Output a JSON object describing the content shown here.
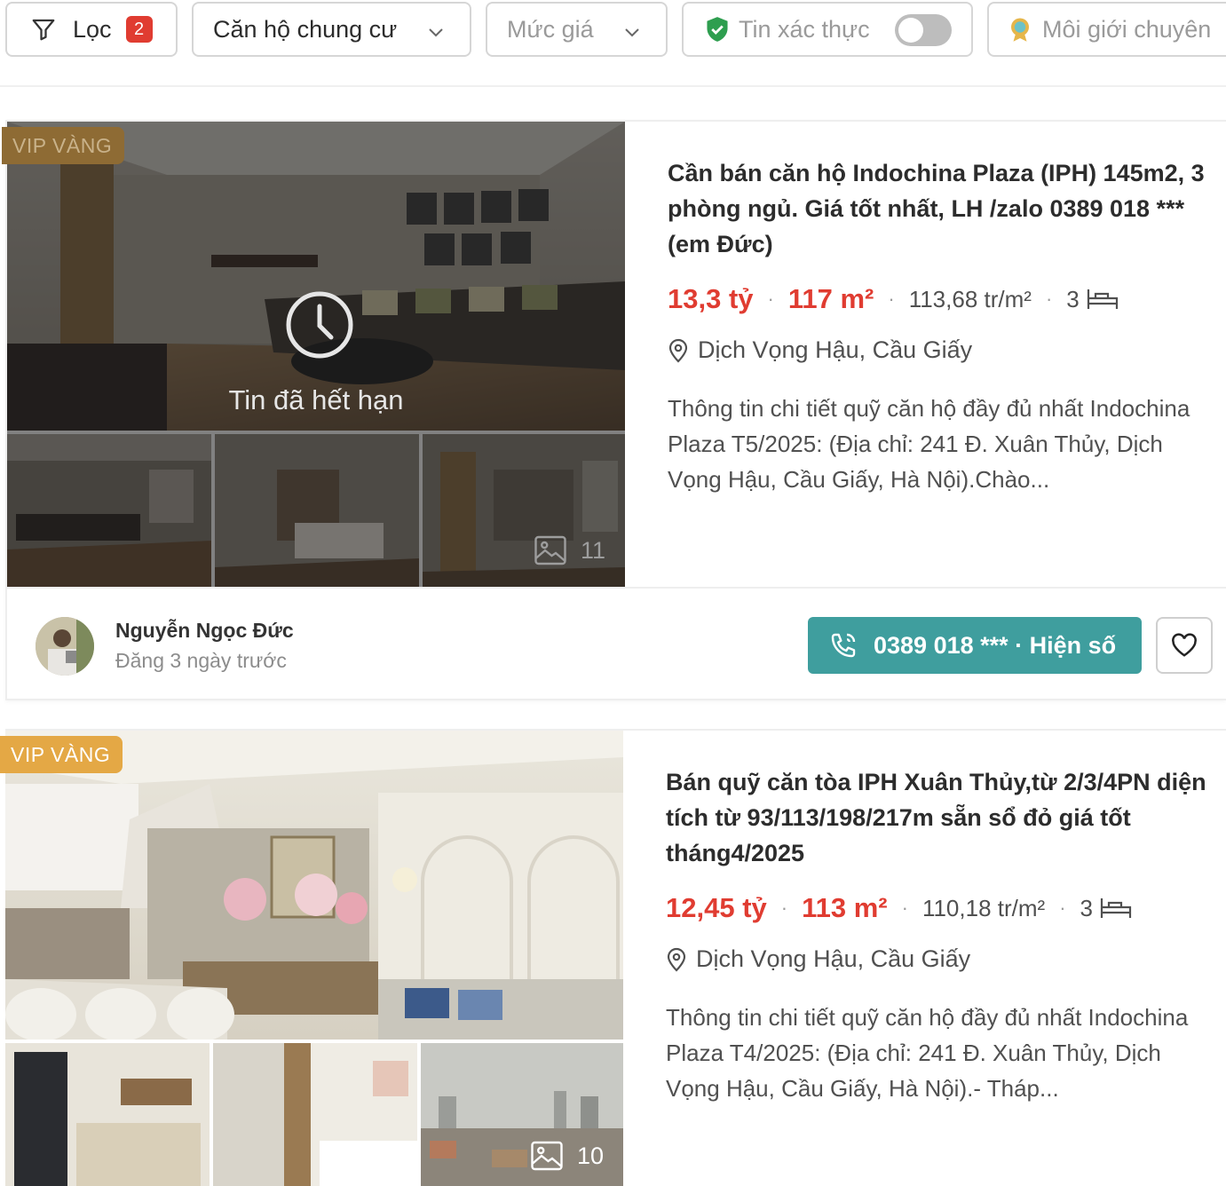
{
  "filters": {
    "filter_label": "Lọc",
    "filter_count": "2",
    "property_type": "Căn hộ chung cư",
    "price_placeholder": "Mức giá",
    "verified_label": "Tin xác thực",
    "verified_on": false,
    "broker_label": "Môi giới chuyên"
  },
  "colors": {
    "accent_red": "#e03c31",
    "phone_button": "#3f9e9e",
    "vip_gold": "#e4a845"
  },
  "listings": [
    {
      "badge": "VIP VÀNG",
      "expired_text": "Tin đã hết hạn",
      "photo_count": "11",
      "title": "Cần bán căn hộ Indochina Plaza (IPH) 145m2, 3 phòng ngủ. Giá tốt nhất, LH /zalo 0389 018 *** (em Đức)",
      "price": "13,3 tỷ",
      "area": "117 m²",
      "price_per_m2": "113,68 tr/m²",
      "bedrooms": "3",
      "location": "Dịch Vọng Hậu, Cầu Giấy",
      "description": "Thông tin chi tiết quỹ căn hộ đầy đủ nhất Indochina Plaza T5/2025: (Địa chỉ: 241 Đ. Xuân Thủy, Dịch Vọng Hậu, Cầu Giấy, Hà Nội).Chào...",
      "agent_name": "Nguyễn Ngọc Đức",
      "posted": "Đăng 3 ngày trước",
      "phone_label": "0389 018 *** · Hiện số"
    },
    {
      "badge": "VIP VÀNG",
      "photo_count": "10",
      "title": "Bán quỹ căn tòa IPH Xuân Thủy,từ 2/3/4PN diện tích từ 93/113/198/217m sẵn sổ đỏ giá tốt tháng4/2025",
      "price": "12,45 tỷ",
      "area": "113 m²",
      "price_per_m2": "110,18 tr/m²",
      "bedrooms": "3",
      "location": "Dịch Vọng Hậu, Cầu Giấy",
      "description": "Thông tin chi tiết quỹ căn hộ đầy đủ nhất Indochina Plaza T4/2025: (Địa chỉ: 241 Đ. Xuân Thủy, Dịch Vọng Hậu, Cầu Giấy, Hà Nội).- Tháp..."
    }
  ]
}
